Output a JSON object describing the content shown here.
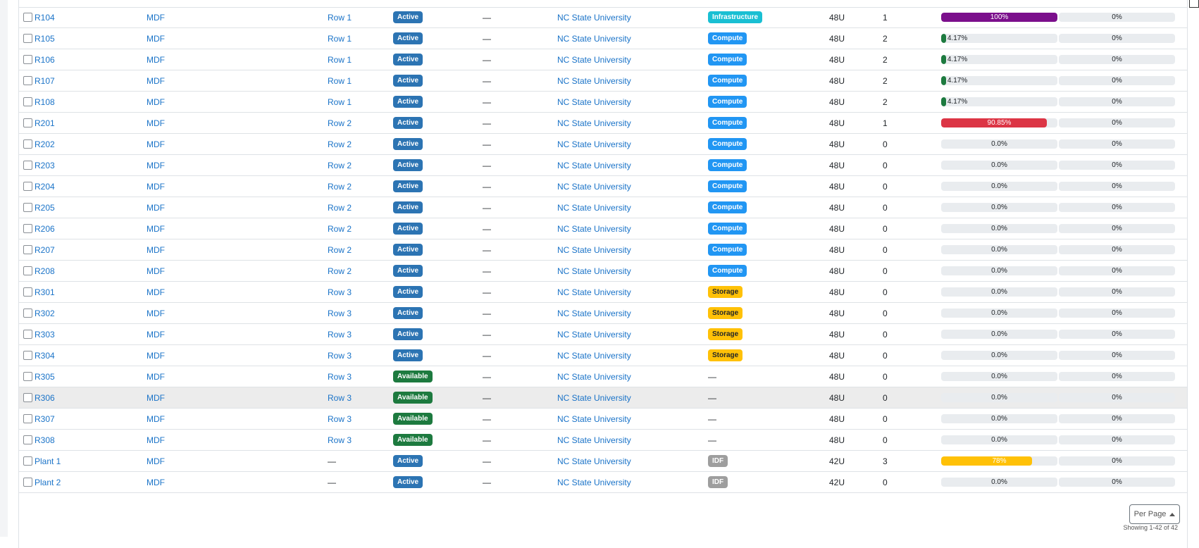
{
  "colors": {
    "link": "#1a73c8",
    "active": "#2c74b3",
    "available": "#1d7a3f",
    "infrastructure": "#19bfd3",
    "compute": "#2196f3",
    "storage": "#ffc107",
    "idf": "#9e9e9e",
    "util_purple": "#7b0f8c",
    "util_green": "#1d7a3f",
    "util_red": "#dc3545",
    "util_yellow": "#ffc107"
  },
  "rows": [
    {
      "name": "R104",
      "location": "MDF",
      "group": "Row 1",
      "status": "Active",
      "role": "—",
      "tenant": "NC State University",
      "type": "Infrastructure",
      "height": "48U",
      "devices": "1",
      "util_label": "100%",
      "util_value": 100,
      "power_label": "0%"
    },
    {
      "name": "R105",
      "location": "MDF",
      "group": "Row 1",
      "status": "Active",
      "role": "—",
      "tenant": "NC State University",
      "type": "Compute",
      "height": "48U",
      "devices": "2",
      "util_label": "4.17%",
      "util_value": 4.17,
      "power_label": "0%"
    },
    {
      "name": "R106",
      "location": "MDF",
      "group": "Row 1",
      "status": "Active",
      "role": "—",
      "tenant": "NC State University",
      "type": "Compute",
      "height": "48U",
      "devices": "2",
      "util_label": "4.17%",
      "util_value": 4.17,
      "power_label": "0%"
    },
    {
      "name": "R107",
      "location": "MDF",
      "group": "Row 1",
      "status": "Active",
      "role": "—",
      "tenant": "NC State University",
      "type": "Compute",
      "height": "48U",
      "devices": "2",
      "util_label": "4.17%",
      "util_value": 4.17,
      "power_label": "0%"
    },
    {
      "name": "R108",
      "location": "MDF",
      "group": "Row 1",
      "status": "Active",
      "role": "—",
      "tenant": "NC State University",
      "type": "Compute",
      "height": "48U",
      "devices": "2",
      "util_label": "4.17%",
      "util_value": 4.17,
      "power_label": "0%"
    },
    {
      "name": "R201",
      "location": "MDF",
      "group": "Row 2",
      "status": "Active",
      "role": "—",
      "tenant": "NC State University",
      "type": "Compute",
      "height": "48U",
      "devices": "1",
      "util_label": "90.85%",
      "util_value": 90.85,
      "power_label": "0%"
    },
    {
      "name": "R202",
      "location": "MDF",
      "group": "Row 2",
      "status": "Active",
      "role": "—",
      "tenant": "NC State University",
      "type": "Compute",
      "height": "48U",
      "devices": "0",
      "util_label": "0.0%",
      "util_value": 0,
      "power_label": "0%"
    },
    {
      "name": "R203",
      "location": "MDF",
      "group": "Row 2",
      "status": "Active",
      "role": "—",
      "tenant": "NC State University",
      "type": "Compute",
      "height": "48U",
      "devices": "0",
      "util_label": "0.0%",
      "util_value": 0,
      "power_label": "0%"
    },
    {
      "name": "R204",
      "location": "MDF",
      "group": "Row 2",
      "status": "Active",
      "role": "—",
      "tenant": "NC State University",
      "type": "Compute",
      "height": "48U",
      "devices": "0",
      "util_label": "0.0%",
      "util_value": 0,
      "power_label": "0%"
    },
    {
      "name": "R205",
      "location": "MDF",
      "group": "Row 2",
      "status": "Active",
      "role": "—",
      "tenant": "NC State University",
      "type": "Compute",
      "height": "48U",
      "devices": "0",
      "util_label": "0.0%",
      "util_value": 0,
      "power_label": "0%"
    },
    {
      "name": "R206",
      "location": "MDF",
      "group": "Row 2",
      "status": "Active",
      "role": "—",
      "tenant": "NC State University",
      "type": "Compute",
      "height": "48U",
      "devices": "0",
      "util_label": "0.0%",
      "util_value": 0,
      "power_label": "0%"
    },
    {
      "name": "R207",
      "location": "MDF",
      "group": "Row 2",
      "status": "Active",
      "role": "—",
      "tenant": "NC State University",
      "type": "Compute",
      "height": "48U",
      "devices": "0",
      "util_label": "0.0%",
      "util_value": 0,
      "power_label": "0%"
    },
    {
      "name": "R208",
      "location": "MDF",
      "group": "Row 2",
      "status": "Active",
      "role": "—",
      "tenant": "NC State University",
      "type": "Compute",
      "height": "48U",
      "devices": "0",
      "util_label": "0.0%",
      "util_value": 0,
      "power_label": "0%"
    },
    {
      "name": "R301",
      "location": "MDF",
      "group": "Row 3",
      "status": "Active",
      "role": "—",
      "tenant": "NC State University",
      "type": "Storage",
      "height": "48U",
      "devices": "0",
      "util_label": "0.0%",
      "util_value": 0,
      "power_label": "0%"
    },
    {
      "name": "R302",
      "location": "MDF",
      "group": "Row 3",
      "status": "Active",
      "role": "—",
      "tenant": "NC State University",
      "type": "Storage",
      "height": "48U",
      "devices": "0",
      "util_label": "0.0%",
      "util_value": 0,
      "power_label": "0%"
    },
    {
      "name": "R303",
      "location": "MDF",
      "group": "Row 3",
      "status": "Active",
      "role": "—",
      "tenant": "NC State University",
      "type": "Storage",
      "height": "48U",
      "devices": "0",
      "util_label": "0.0%",
      "util_value": 0,
      "power_label": "0%"
    },
    {
      "name": "R304",
      "location": "MDF",
      "group": "Row 3",
      "status": "Active",
      "role": "—",
      "tenant": "NC State University",
      "type": "Storage",
      "height": "48U",
      "devices": "0",
      "util_label": "0.0%",
      "util_value": 0,
      "power_label": "0%"
    },
    {
      "name": "R305",
      "location": "MDF",
      "group": "Row 3",
      "status": "Available",
      "role": "—",
      "tenant": "NC State University",
      "type": "",
      "height": "48U",
      "devices": "0",
      "util_label": "0.0%",
      "util_value": 0,
      "power_label": "0%"
    },
    {
      "name": "R306",
      "location": "MDF",
      "group": "Row 3",
      "status": "Available",
      "role": "—",
      "tenant": "NC State University",
      "type": "",
      "height": "48U",
      "devices": "0",
      "util_label": "0.0%",
      "util_value": 0,
      "power_label": "0%",
      "highlighted": true
    },
    {
      "name": "R307",
      "location": "MDF",
      "group": "Row 3",
      "status": "Available",
      "role": "—",
      "tenant": "NC State University",
      "type": "",
      "height": "48U",
      "devices": "0",
      "util_label": "0.0%",
      "util_value": 0,
      "power_label": "0%"
    },
    {
      "name": "R308",
      "location": "MDF",
      "group": "Row 3",
      "status": "Available",
      "role": "—",
      "tenant": "NC State University",
      "type": "",
      "height": "48U",
      "devices": "0",
      "util_label": "0.0%",
      "util_value": 0,
      "power_label": "0%"
    },
    {
      "name": "Plant 1",
      "location": "MDF",
      "group": "",
      "status": "Active",
      "role": "—",
      "tenant": "NC State University",
      "type": "IDF",
      "height": "42U",
      "devices": "3",
      "util_label": "78%",
      "util_value": 78,
      "power_label": "0%"
    },
    {
      "name": "Plant 2",
      "location": "MDF",
      "group": "",
      "status": "Active",
      "role": "—",
      "tenant": "NC State University",
      "type": "IDF",
      "height": "42U",
      "devices": "0",
      "util_label": "0.0%",
      "util_value": 0,
      "power_label": "0%"
    }
  ],
  "pagination": {
    "per_page_label": "Per Page",
    "showing_text": "Showing 1-42 of 42"
  }
}
